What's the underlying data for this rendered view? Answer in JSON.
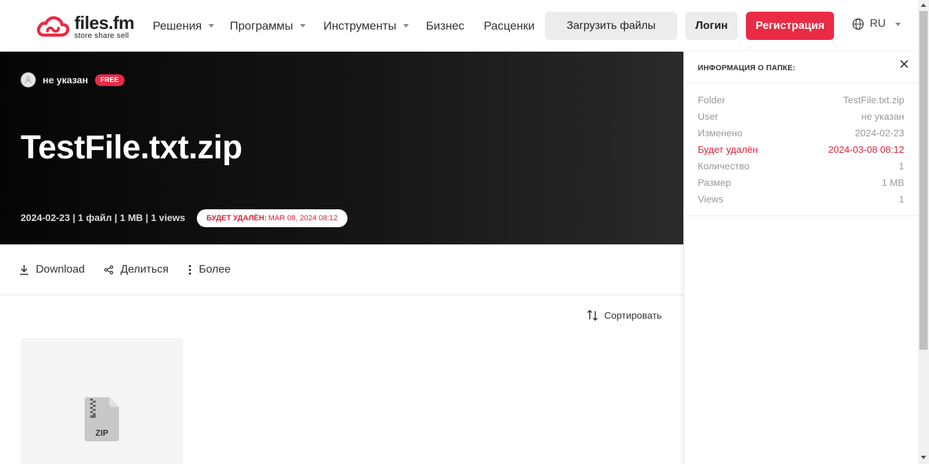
{
  "header": {
    "logo_name": "files.fm",
    "logo_tag": "store share sell",
    "nav": [
      {
        "label": "Решения",
        "caret": true
      },
      {
        "label": "Программы",
        "caret": true
      },
      {
        "label": "Инструменты",
        "caret": true
      },
      {
        "label": "Бизнес",
        "caret": false
      },
      {
        "label": "Расценки",
        "caret": false
      }
    ],
    "upload_label": "Загрузить файлы",
    "login_label": "Логин",
    "register_label": "Регистрация",
    "language": "RU"
  },
  "hero": {
    "owner_name": "не указан",
    "plan_badge": "FREE",
    "title": "TestFile.txt.zip",
    "meta": "2024-02-23 | 1 файл | 1 MB | 1 views",
    "delete_label": "БУДЕТ УДАЛЁН:",
    "delete_value": "MAR 08, 2024 08:12"
  },
  "actions": {
    "download": "Download",
    "share": "Делиться",
    "more": "Более"
  },
  "sort_label": "Сортировать",
  "file_tile": {
    "type_label": "ZIP"
  },
  "panel": {
    "title": "ИНФОРМАЦИЯ О ПАПКЕ:",
    "rows": [
      {
        "key": "Folder",
        "value": "TestFile.txt.zip"
      },
      {
        "key": "User",
        "value": "не указан"
      },
      {
        "key": "Изменено",
        "value": "2024-02-23"
      },
      {
        "key": "Будет удалён",
        "value": "2024-03-08 08:12"
      },
      {
        "key": "Количество",
        "value": "1"
      },
      {
        "key": "Размер",
        "value": "1 MB"
      },
      {
        "key": "Views",
        "value": "1"
      }
    ]
  },
  "colors": {
    "accent": "#ea2b45",
    "warning_text": "#d9233a"
  }
}
